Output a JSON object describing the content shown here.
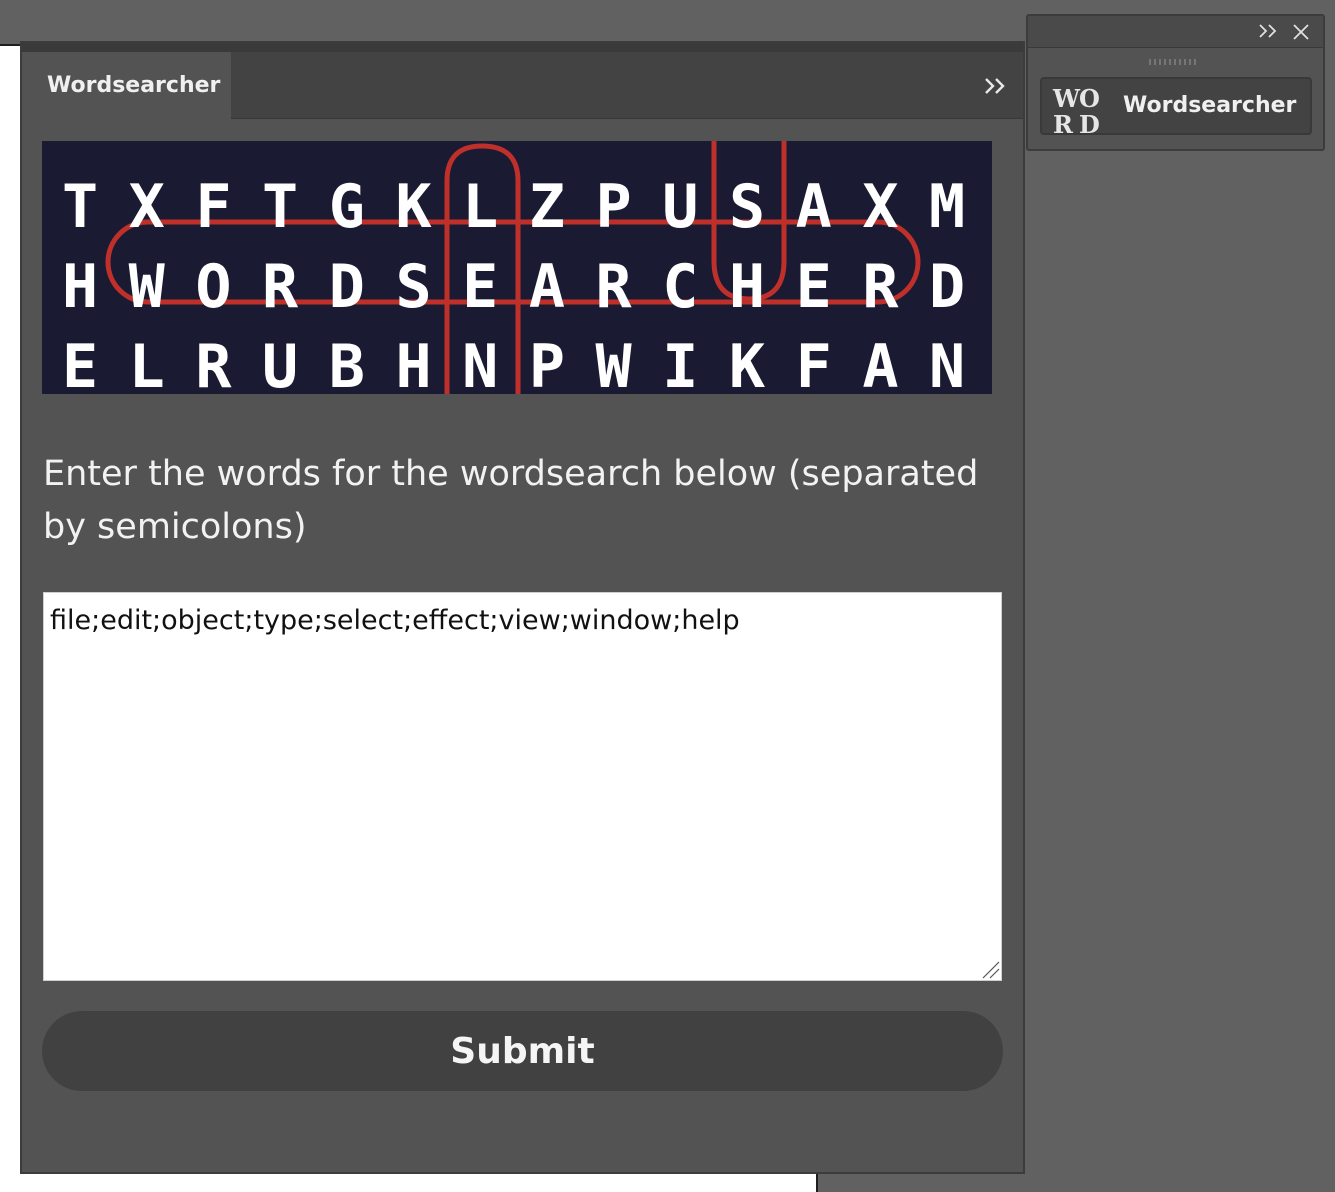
{
  "panel": {
    "tab_label": "Wordsearcher",
    "menu_icon": "double-chevron-right-icon"
  },
  "banner": {
    "rows": [
      "TXFTGKLZPUSAXM",
      "HWORDSEARCHERD",
      "ELRUBHNPWIKFAN"
    ],
    "highlight_color": "#c0302a",
    "background_color": "#1a1a33"
  },
  "instructions": {
    "text": "Enter the words for the wordsearch below (separated by semicolons)"
  },
  "words_input": {
    "value": "file;edit;object;type;select;effect;view;window;help"
  },
  "submit": {
    "label": "Submit"
  },
  "side_panel": {
    "expand_icon": "double-chevron-right-icon",
    "close_icon": "close-icon",
    "plugin_label": "Wordsearcher",
    "logo_letters": [
      "W",
      "O",
      "R",
      "D"
    ]
  },
  "colors": {
    "app_background": "#616161",
    "panel_background": "#535353",
    "button_background": "#414141",
    "accent_red": "#c0302a"
  }
}
